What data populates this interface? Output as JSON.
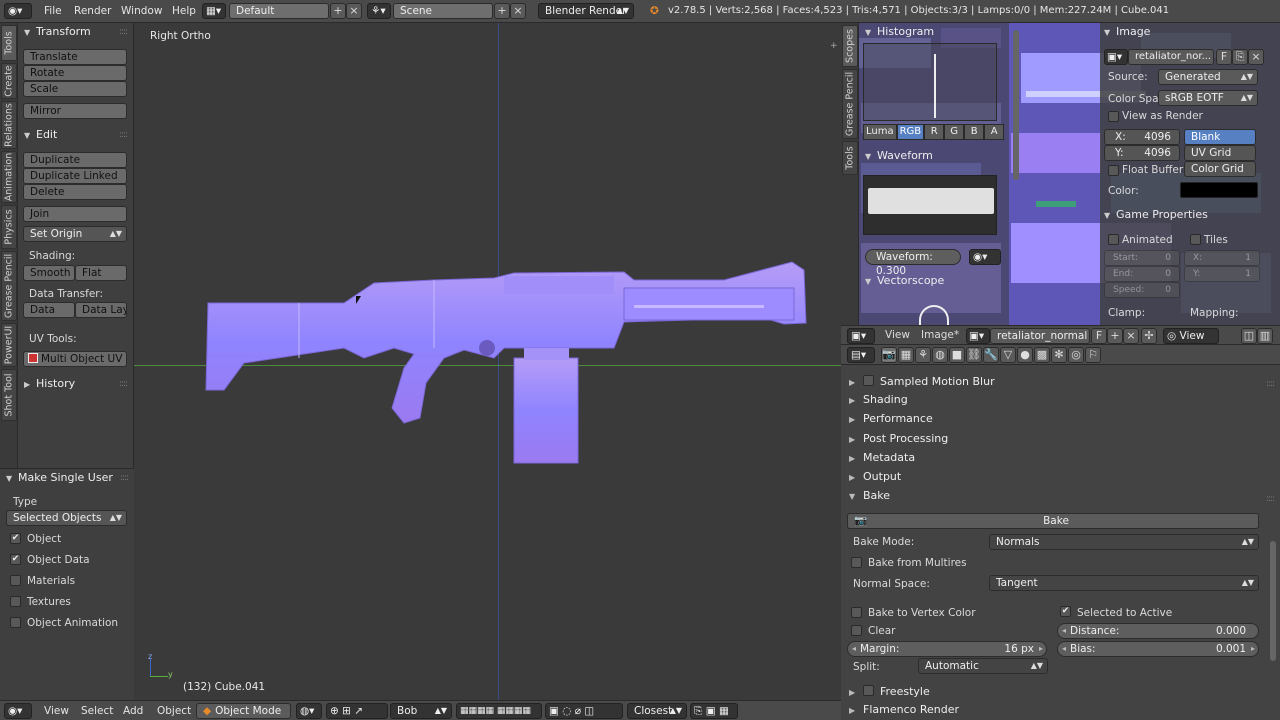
{
  "topbar": {
    "menus": [
      "File",
      "Render",
      "Window",
      "Help"
    ],
    "layout": "Default",
    "scene": "Scene",
    "engine": "Blender Render",
    "stats": "v2.78.5 | Verts:2,568 | Faces:4,523 | Tris:4,571 | Objects:3/3 | Lamps:0/0 | Mem:227.24M | Cube.041"
  },
  "vtabs": [
    "Tools",
    "Create",
    "Relations",
    "Animation",
    "Physics",
    "Grease Pencil",
    "PowerUI",
    "Shot Tool"
  ],
  "toolshelf": {
    "transform": {
      "title": "Transform",
      "buttons": [
        "Translate",
        "Rotate",
        "Scale",
        "Mirror"
      ]
    },
    "edit": {
      "title": "Edit",
      "buttons": [
        "Duplicate",
        "Duplicate Linked",
        "Delete",
        "Join"
      ],
      "set_origin": "Set Origin"
    },
    "shading": {
      "label": "Shading:",
      "smooth": "Smooth",
      "flat": "Flat"
    },
    "data_transfer": {
      "label": "Data Transfer:",
      "data": "Data",
      "data_layout": "Data Layo"
    },
    "uv_tools": {
      "label": "UV Tools:",
      "button": "Multi Object UV E..."
    },
    "history": "History"
  },
  "operator": {
    "title": "Make Single User",
    "type_label": "Type",
    "type_value": "Selected Objects",
    "options": [
      {
        "label": "Object",
        "checked": true
      },
      {
        "label": "Object Data",
        "checked": true
      },
      {
        "label": "Materials",
        "checked": false
      },
      {
        "label": "Textures",
        "checked": false
      },
      {
        "label": "Object Animation",
        "checked": false
      }
    ]
  },
  "viewport": {
    "view_name": "Right Ortho",
    "object_info": "(132) Cube.041"
  },
  "bottombar": {
    "menus": [
      "View",
      "Select",
      "Add",
      "Object"
    ],
    "mode": "Object Mode",
    "layer": "Bob",
    "snap": "Closest"
  },
  "image_editor": {
    "scopes_tabs": [
      "Scopes",
      "Grease Pencil",
      "Tools"
    ],
    "histogram": {
      "title": "Histogram",
      "channels": [
        "Luma",
        "RGB",
        "R",
        "G",
        "B",
        "A"
      ],
      "active": "RGB"
    },
    "waveform": {
      "title": "Waveform",
      "value_label": "Waveform: 0.300"
    },
    "vectorscope": {
      "title": "Vectorscope"
    },
    "image_panel": {
      "title": "Image",
      "image_name": "retaliator_nor...",
      "source_label": "Source:",
      "source": "Generated",
      "colorspace_label": "Color Spa",
      "colorspace": "sRGB EOTF",
      "view_as_render": "View as Render",
      "x_label": "X:",
      "x": "4096",
      "y_label": "Y:",
      "y": "4096",
      "gen_types": [
        "Blank",
        "UV Grid",
        "Color Grid"
      ],
      "gen_active": "Blank",
      "float_buffer": "Float Buffer",
      "color_label": "Color:",
      "color_value": "#000000"
    },
    "game_props": {
      "title": "Game Properties",
      "animated": "Animated",
      "tiles": "Tiles",
      "start": "Start:",
      "start_v": "0",
      "end": "End:",
      "end_v": "0",
      "speed": "Speed:",
      "speed_v": "0",
      "gx": "X:",
      "gx_v": "1",
      "gy": "Y:",
      "gy_v": "1",
      "clamp": "Clamp:",
      "mapping": "Mapping:"
    },
    "header": {
      "view": "View",
      "image_menu": "Image*",
      "image_name": "retaliator_normal",
      "f": "F",
      "view2": "View"
    }
  },
  "render_props": {
    "sections": [
      "Sampled Motion Blur",
      "Shading",
      "Performance",
      "Post Processing",
      "Metadata",
      "Output"
    ],
    "bake": {
      "title": "Bake",
      "button": "Bake",
      "mode_label": "Bake Mode:",
      "mode": "Normals",
      "multires": "Bake from Multires",
      "normal_space_label": "Normal Space:",
      "normal_space": "Tangent",
      "vertex_color": "Bake to Vertex Color",
      "selected_to_active": "Selected to Active",
      "clear": "Clear",
      "distance_label": "Distance:",
      "distance": "0.000",
      "margin_label": "Margin:",
      "margin": "16 px",
      "bias_label": "Bias:",
      "bias": "0.001",
      "split_label": "Split:",
      "split": "Automatic"
    },
    "after": [
      "Freestyle",
      "Flamenco Render"
    ]
  },
  "colors": {
    "accent": "#5680c2",
    "normal_map": "#8080ff",
    "axis_green": "#4c8a3c",
    "axis_blue": "#3a4d8c"
  }
}
